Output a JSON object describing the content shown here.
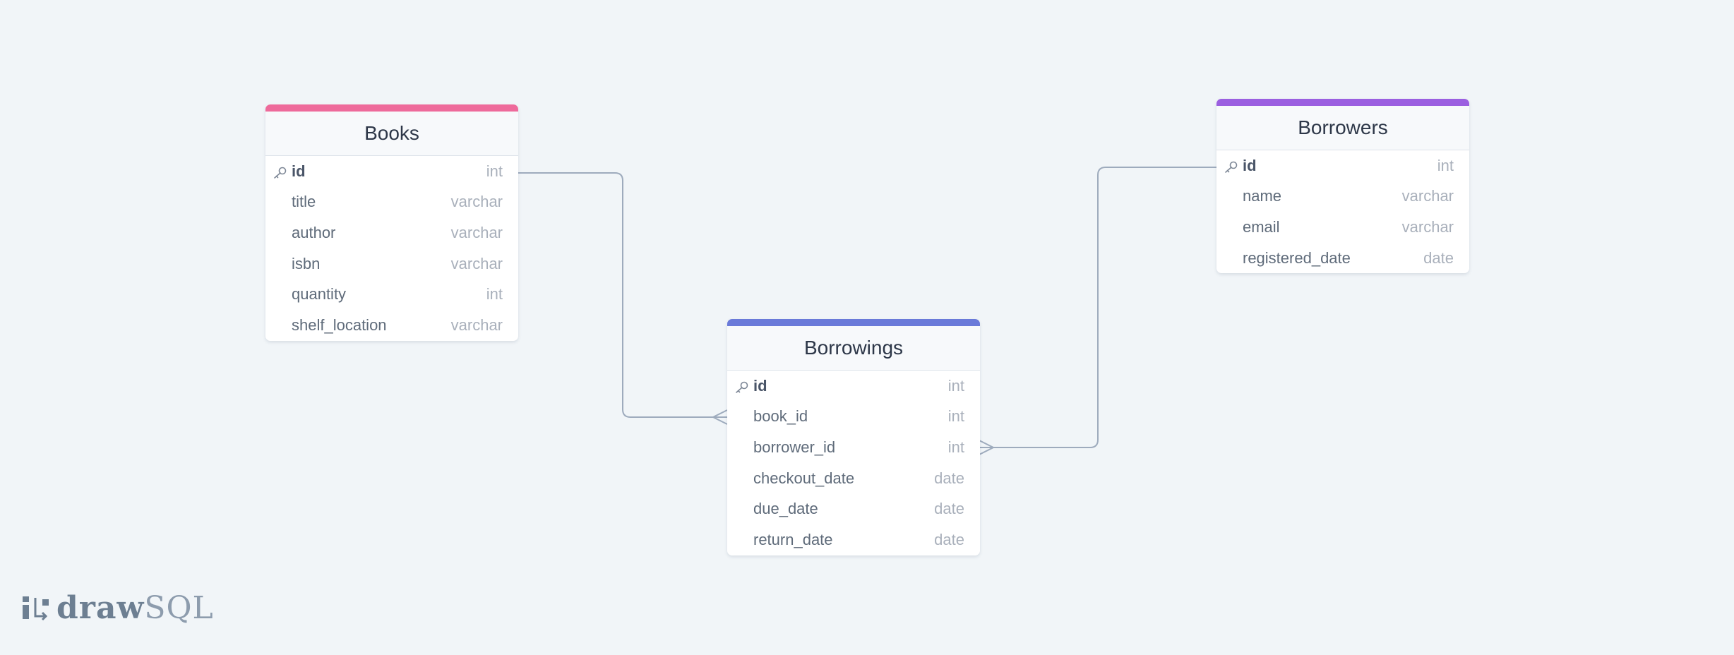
{
  "diagram": {
    "tables": [
      {
        "id": "books",
        "title": "Books",
        "accent": "#ee6a9b",
        "columns": [
          {
            "name": "id",
            "type": "int",
            "pk": true
          },
          {
            "name": "title",
            "type": "varchar",
            "pk": false
          },
          {
            "name": "author",
            "type": "varchar",
            "pk": false
          },
          {
            "name": "isbn",
            "type": "varchar",
            "pk": false
          },
          {
            "name": "quantity",
            "type": "int",
            "pk": false
          },
          {
            "name": "shelf_location",
            "type": "varchar",
            "pk": false
          }
        ]
      },
      {
        "id": "borrowings",
        "title": "Borrowings",
        "accent": "#6a7ad9",
        "columns": [
          {
            "name": "id",
            "type": "int",
            "pk": true
          },
          {
            "name": "book_id",
            "type": "int",
            "pk": false
          },
          {
            "name": "borrower_id",
            "type": "int",
            "pk": false
          },
          {
            "name": "checkout_date",
            "type": "date",
            "pk": false
          },
          {
            "name": "due_date",
            "type": "date",
            "pk": false
          },
          {
            "name": "return_date",
            "type": "date",
            "pk": false
          }
        ]
      },
      {
        "id": "borrowers",
        "title": "Borrowers",
        "accent": "#9b5fe0",
        "columns": [
          {
            "name": "id",
            "type": "int",
            "pk": true
          },
          {
            "name": "name",
            "type": "varchar",
            "pk": false
          },
          {
            "name": "email",
            "type": "varchar",
            "pk": false
          },
          {
            "name": "registered_date",
            "type": "date",
            "pk": false
          }
        ]
      }
    ],
    "relationships": [
      {
        "from": "books.id",
        "to": "borrowings.book_id",
        "cardinality": "one-to-many"
      },
      {
        "from": "borrowers.id",
        "to": "borrowings.borrower_id",
        "cardinality": "one-to-many"
      }
    ],
    "line_color": "#9eabbd",
    "key_icon": "key-icon"
  },
  "branding": {
    "logo_bold": "draw",
    "logo_light": "SQL",
    "icon": "drawsql-logo-icon"
  }
}
